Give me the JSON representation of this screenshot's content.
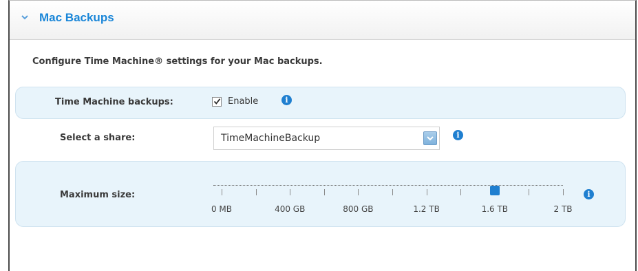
{
  "header": {
    "title": "Mac Backups"
  },
  "description": "Configure Time Machine® settings for your Mac backups.",
  "time_machine": {
    "label": "Time Machine backups:",
    "enable_label": "Enable",
    "checked": true
  },
  "share": {
    "label": "Select a share:",
    "selected": "TimeMachineBackup"
  },
  "max_size": {
    "label": "Maximum size:",
    "tick_labels": [
      "0 MB",
      "400 GB",
      "800 GB",
      "1.2 TB",
      "1.6 TB",
      "2 TB"
    ],
    "value_fraction": 0.8
  },
  "icons": {
    "info": "i"
  },
  "colors": {
    "accent": "#1f7fd0",
    "title": "#1a86d8",
    "panel": "#e8f4fb"
  }
}
